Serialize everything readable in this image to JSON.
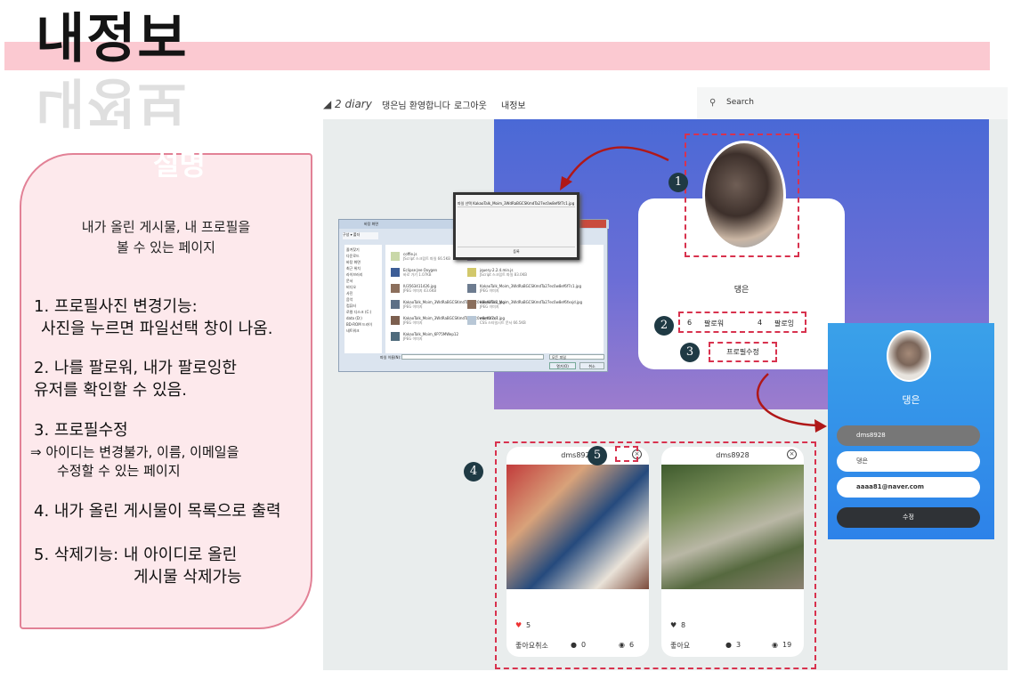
{
  "page_title": "내정보",
  "panel": {
    "label": "설명",
    "intro_line1": "내가 올린 게시물, 내 프로필을",
    "intro_line2": "볼 수 있는 페이지",
    "notes": [
      "1. 프로필사진 변경기능:",
      "사진을 누르면 파일선택 창이 나옴.",
      "2. 나를 팔로워, 내가 팔로잉한",
      "유저를 확인할 수 있음.",
      "3. 프로필수정",
      "⇒ 아이디는 변경불가, 이름, 이메일을",
      "수정할 수 있는 페이지",
      "4. 내가 올린 게시물이 목록으로 출력",
      "5. 삭제기능: 내 아이디로 올린",
      "게시물 삭제가능"
    ]
  },
  "app": {
    "brand": "2 diary",
    "nav": [
      "댕은님 환영합니다",
      "로그아웃",
      "내정보"
    ],
    "search_placeholder": "Search",
    "profile": {
      "name": "댕은",
      "followers_count": "6",
      "followers_label": "팔로워",
      "following_count": "4",
      "following_label": "팔로잉",
      "edit_label": "프로필수정"
    },
    "callouts": [
      "1",
      "2",
      "3",
      "4",
      "5"
    ],
    "file_dialog": {
      "title": "바탕 화면",
      "modal_title": "파일 선택 KakaoTalk_Moim_3WdRaBGCSKmdTa27ec0w8ef6f7c1.jpg",
      "modal_button": "등록",
      "filename_label": "파일 이름(N):",
      "filter": "모든 파일",
      "open_button": "열기(O)",
      "cancel_button": "취소",
      "sidebar": [
        "즐겨찾기",
        "다운로드",
        "바탕 화면",
        "최근 위치",
        "라이브러리",
        "문서",
        "비디오",
        "사진",
        "음악",
        "컴퓨터",
        "로컬 디스크 (C:)",
        "data (D:)",
        "BD-ROM 드라이",
        "네트워크"
      ],
      "files": [
        {
          "name": "coffie.js",
          "info": "JScript 스크립트 파일 66.5KB"
        },
        {
          "name": "Eclipse Jee Oxygen",
          "info": "바로 가기 1.07KB"
        },
        {
          "name": "IU3563411426.jpg",
          "info": "JPEG 이미지 43.6KB"
        },
        {
          "name": "KakaoTalk_Moim_3WdRaBGCSKmdTa27ec0w8ef6f7c1.jpg",
          "info": "JPEG 이미지"
        },
        {
          "name": "KakaoTalk_Moim_3WdRaBGCSKmdTa27ec0w8ef6f7c7.jpg",
          "info": "JPEG 이미지"
        },
        {
          "name": "KakaoTalk_Moim_6P75MWep12",
          "info": "JPEG 이미지"
        },
        {
          "name": "eclipse-inst-win64.exe",
          "info": "2018-06-04 오후 2:57 48.4MB"
        },
        {
          "name": "jquery-2.2.4.min.js",
          "info": "JScript 스크립트 파일 83.0KB"
        },
        {
          "name": "KakaoTalk_Moim_3WdRaBGCSKmdTa27ec0w8ef6f7c1.jpg",
          "info": "JPEG 이미지"
        },
        {
          "name": "KakaoTalk_Moim_3WdRaBGCSKmdTa27ec0w8ef6fxxjd.jpg",
          "info": "JPEG 이미지"
        },
        {
          "name": "mama.css",
          "info": "CSS 스타일시트 문서 66.5KB"
        }
      ]
    },
    "edit_panel": {
      "name": "댕은",
      "user_id": "dms8928",
      "name_value": "댕은",
      "email": "aaaa81@naver.com",
      "submit_label": "수정"
    },
    "posts": [
      {
        "user": "dms8928",
        "likes": "5",
        "like_action": "좋아요취소",
        "comments": "0",
        "views": "6",
        "liked": true
      },
      {
        "user": "dms8928",
        "likes": "8",
        "like_action": "좋아요",
        "comments": "3",
        "views": "19",
        "liked": false
      }
    ]
  },
  "colors": {
    "title_band": "#fbc9d1",
    "panel_border": "#e28196",
    "callout_dash": "#d8324e",
    "arrow": "#b01818",
    "edit_panel": "#2d82e9"
  }
}
